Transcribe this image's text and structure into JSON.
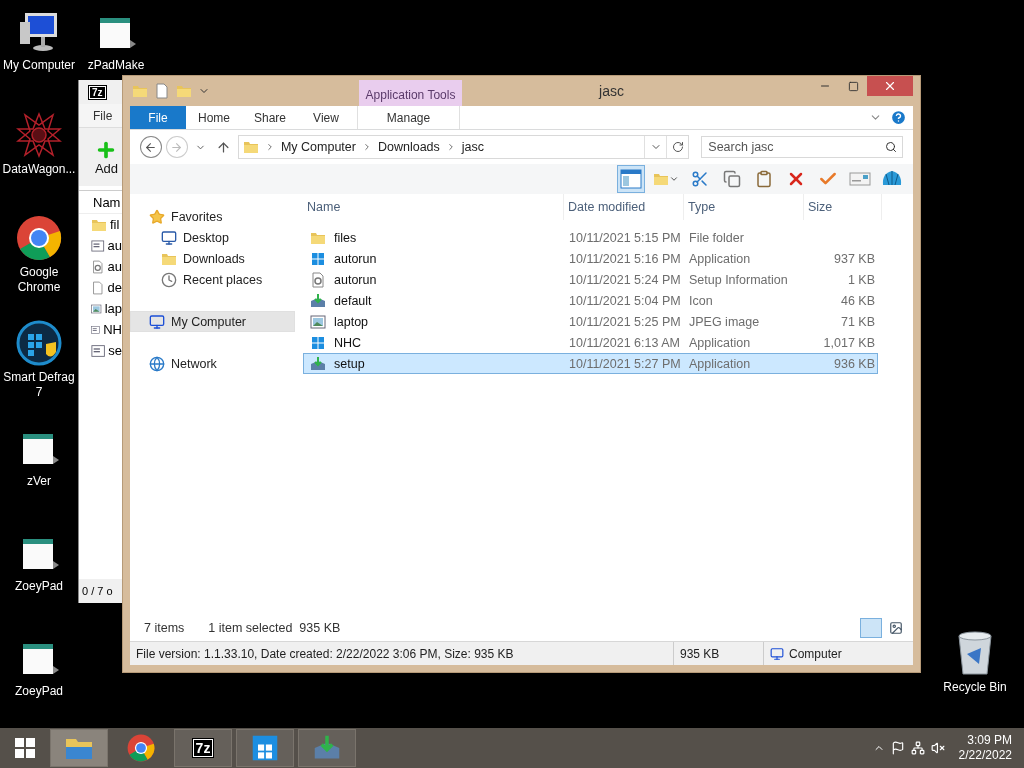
{
  "desktop_icons": [
    {
      "label": "My Computer",
      "kind": "computer"
    },
    {
      "label": "zPadMake",
      "kind": "pad"
    },
    {
      "label": "DataWagon...",
      "kind": "star"
    },
    {
      "label": "Google Chrome",
      "kind": "chrome"
    },
    {
      "label": "Smart Defrag 7",
      "kind": "defrag"
    },
    {
      "label": "zVer",
      "kind": "pad"
    },
    {
      "label": "ZoeyPad",
      "kind": "pad"
    },
    {
      "label": "ZoeyPad",
      "kind": "pad"
    },
    {
      "label": "Recycle Bin",
      "kind": "bin"
    }
  ],
  "back_window": {
    "logo": "7z",
    "menu": "File",
    "toolbar_button": "Add",
    "column": "Nam",
    "rows": [
      {
        "name": "fil",
        "kind": "folder"
      },
      {
        "name": "au",
        "kind": "app"
      },
      {
        "name": "au",
        "kind": "settings"
      },
      {
        "name": "de",
        "kind": "blank"
      },
      {
        "name": "lap",
        "kind": "image"
      },
      {
        "name": "NH",
        "kind": "app"
      },
      {
        "name": "se",
        "kind": "app"
      }
    ],
    "status": "0 / 7 o"
  },
  "explorer": {
    "title": "jasc",
    "context_group": "Application Tools",
    "ribbon_tabs": [
      {
        "label": "File",
        "kind": "file",
        "selected": false
      },
      {
        "label": "Home",
        "kind": "tab",
        "selected": false
      },
      {
        "label": "Share",
        "kind": "tab",
        "selected": false
      },
      {
        "label": "View",
        "kind": "tab",
        "selected": false
      },
      {
        "label": "Manage",
        "kind": "context",
        "selected": false
      }
    ],
    "breadcrumbs": [
      "My Computer",
      "Downloads",
      "jasc"
    ],
    "search": {
      "placeholder": "Search jasc"
    },
    "nav": [
      {
        "label": "Favorites",
        "kind": "star",
        "selected": false,
        "children": [
          {
            "label": "Desktop",
            "kind": "desktop",
            "selected": false
          },
          {
            "label": "Downloads",
            "kind": "downloads",
            "selected": false
          },
          {
            "label": "Recent places",
            "kind": "recent",
            "selected": false
          }
        ]
      },
      {
        "label": "My Computer",
        "kind": "computer",
        "selected": true
      },
      {
        "label": "Network",
        "kind": "network",
        "selected": false
      }
    ],
    "columns": [
      "Name",
      "Date modified",
      "Type",
      "Size"
    ],
    "rows": [
      {
        "name": "files",
        "date": "10/11/2021 5:15 PM",
        "type": "File folder",
        "size": "",
        "kind": "folder",
        "selected": false
      },
      {
        "name": "autorun",
        "date": "10/11/2021 5:16 PM",
        "type": "Application",
        "size": "937 KB",
        "kind": "windows",
        "selected": false
      },
      {
        "name": "autorun",
        "date": "10/11/2021 5:24 PM",
        "type": "Setup Information",
        "size": "1 KB",
        "kind": "settings",
        "selected": false
      },
      {
        "name": "default",
        "date": "10/11/2021 5:04 PM",
        "type": "Icon",
        "size": "46 KB",
        "kind": "install",
        "selected": false
      },
      {
        "name": "laptop",
        "date": "10/11/2021 5:25 PM",
        "type": "JPEG image",
        "size": "71 KB",
        "kind": "image",
        "selected": false
      },
      {
        "name": "NHC",
        "date": "10/11/2021 6:13 AM",
        "type": "Application",
        "size": "1,017 KB",
        "kind": "windows",
        "selected": false
      },
      {
        "name": "setup",
        "date": "10/11/2021 5:27 PM",
        "type": "Application",
        "size": "936 KB",
        "kind": "install",
        "selected": true
      }
    ],
    "item_count": "7 items",
    "selection_info": "1 item selected  935 KB",
    "status_bar": {
      "details": "File version: 1.1.33.10, Date created: 2/22/2022 3:06 PM, Size: 935 KB",
      "size": "935 KB",
      "location": "Computer"
    }
  },
  "taskbar": {
    "apps": [
      {
        "kind": "explorer",
        "active": true,
        "running": true
      },
      {
        "kind": "chrome",
        "active": false,
        "running": false
      },
      {
        "kind": "sevenzip",
        "label": "7z",
        "active": false,
        "running": true
      },
      {
        "kind": "windows",
        "active": false,
        "running": true
      },
      {
        "kind": "install",
        "active": false,
        "running": true
      }
    ],
    "time": "3:09 PM",
    "date": "2/22/2022"
  }
}
